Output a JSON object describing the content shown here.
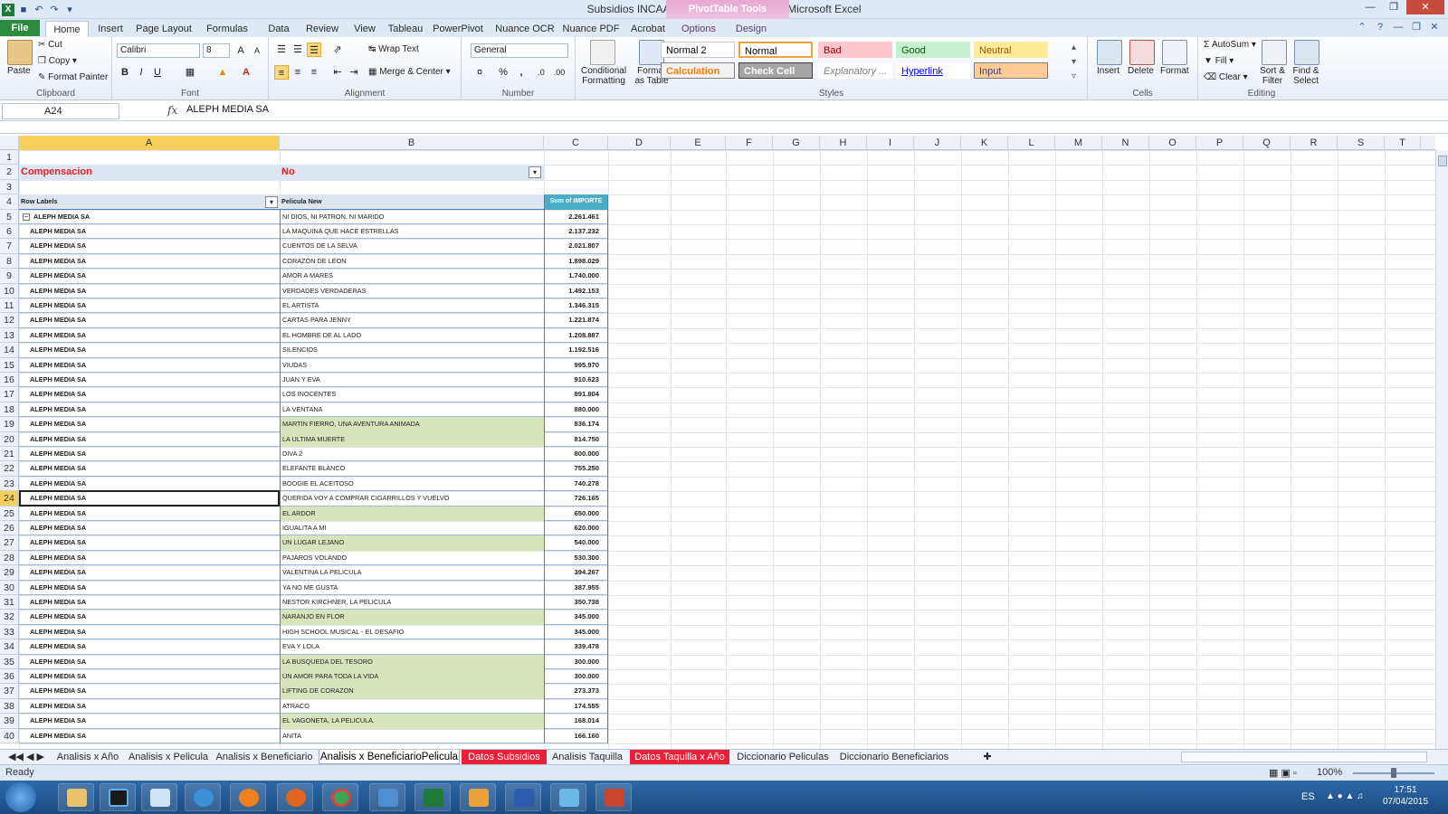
{
  "window": {
    "title": "Subsidios INCAA Analisis20141117.xlsx - Microsoft Excel",
    "contextual_tab_group": "PivotTable Tools"
  },
  "tabs": [
    "File",
    "Home",
    "Insert",
    "Page Layout",
    "Formulas",
    "Data",
    "Review",
    "View",
    "Tableau",
    "PowerPivot",
    "Nuance OCR",
    "Nuance PDF",
    "Acrobat",
    "Options",
    "Design"
  ],
  "ribbon": {
    "clipboard": {
      "paste": "Paste",
      "cut": "Cut",
      "copy": "Copy",
      "format_painter": "Format Painter",
      "label": "Clipboard"
    },
    "font": {
      "name": "Calibri",
      "size": "8",
      "label": "Font",
      "bold": "B",
      "italic": "I",
      "underline": "U"
    },
    "alignment": {
      "wrap_text": "Wrap Text",
      "merge_center": "Merge & Center",
      "label": "Alignment"
    },
    "number": {
      "format": "General",
      "label": "Number",
      "percent": "%",
      "comma": ","
    },
    "styles": {
      "conditional_formatting": "Conditional Formatting",
      "format_as_table": "Format as Table",
      "label": "Styles",
      "gallery": [
        {
          "name": "Normal 2",
          "bg": "#ffffff",
          "fg": "#000000",
          "border": "#c9c9c9"
        },
        {
          "name": "Normal",
          "bg": "#ffffff",
          "fg": "#000000",
          "border": "#f0a33a"
        },
        {
          "name": "Bad",
          "bg": "#ffc7ce",
          "fg": "#9c0006",
          "border": "#ffc7ce"
        },
        {
          "name": "Good",
          "bg": "#c6efce",
          "fg": "#006100",
          "border": "#c6efce"
        },
        {
          "name": "Neutral",
          "bg": "#ffeb9c",
          "fg": "#9c5700",
          "border": "#ffeb9c"
        },
        {
          "name": "Calculation",
          "bg": "#f2f2f2",
          "fg": "#fa7d00",
          "border": "#7f7f7f"
        },
        {
          "name": "Check Cell",
          "bg": "#a5a5a5",
          "fg": "#ffffff",
          "border": "#3f3f3f"
        },
        {
          "name": "Explanatory ...",
          "bg": "#ffffff",
          "fg": "#7f7f7f",
          "border": "#ffffff"
        },
        {
          "name": "Hyperlink",
          "bg": "#ffffff",
          "fg": "#0000ff",
          "border": "#ffffff"
        },
        {
          "name": "Input",
          "bg": "#ffcc99",
          "fg": "#3f3f76",
          "border": "#7f7f7f"
        }
      ]
    },
    "cells": {
      "insert": "Insert",
      "delete": "Delete",
      "format": "Format",
      "label": "Cells"
    },
    "editing": {
      "autosum": "AutoSum",
      "fill": "Fill",
      "clear": "Clear",
      "sort_filter": "Sort & Filter",
      "find_select": "Find & Select",
      "label": "Editing"
    }
  },
  "formula_bar": {
    "name_box": "A24",
    "fx": "fx",
    "content": "ALEPH MEDIA SA"
  },
  "columns": [
    "A",
    "B",
    "C",
    "D",
    "E",
    "F",
    "G",
    "H",
    "I",
    "J",
    "K",
    "L",
    "M",
    "N",
    "O",
    "P",
    "Q",
    "R",
    "S",
    "T"
  ],
  "rows": [
    "1",
    "2",
    "3",
    "4",
    "5",
    "6",
    "7",
    "8",
    "9",
    "10",
    "11",
    "12",
    "13",
    "14",
    "15",
    "16",
    "17",
    "18",
    "19",
    "20",
    "21",
    "22",
    "23",
    "24",
    "25",
    "26",
    "27",
    "28",
    "29",
    "30",
    "31",
    "32",
    "33",
    "34",
    "35",
    "36",
    "37",
    "38",
    "39",
    "40"
  ],
  "pivot": {
    "filter_label": "Compensacion",
    "filter_value": "No",
    "header_row_labels": "Row Labels",
    "header_pelicula": "Pelicula New",
    "header_sum": "Sum of IMPORTE",
    "filter_color": "#e21f26",
    "highlight_color": "#d8e4bc",
    "header_bg": "#4bacc6",
    "records": [
      {
        "ben": "ALEPH MEDIA SA",
        "pel": "NI DIOS, NI PATRON, NI MARIDO",
        "imp": "2.261.461",
        "hl": false
      },
      {
        "ben": "ALEPH MEDIA SA",
        "pel": "LA MAQUINA QUE HACE ESTRELLAS",
        "imp": "2.137.232",
        "hl": false
      },
      {
        "ben": "ALEPH MEDIA SA",
        "pel": "CUENTOS DE LA SELVA",
        "imp": "2.021.807",
        "hl": false
      },
      {
        "ben": "ALEPH MEDIA SA",
        "pel": "CORAZON DE LEON",
        "imp": "1.898.029",
        "hl": false
      },
      {
        "ben": "ALEPH MEDIA SA",
        "pel": "AMOR A MARES",
        "imp": "1.740.000",
        "hl": false
      },
      {
        "ben": "ALEPH MEDIA SA",
        "pel": "VERDADES VERDADERAS",
        "imp": "1.492.153",
        "hl": false
      },
      {
        "ben": "ALEPH MEDIA SA",
        "pel": "EL ARTISTA",
        "imp": "1.346.315",
        "hl": false
      },
      {
        "ben": "ALEPH MEDIA SA",
        "pel": "CARTAS PARA JENNY",
        "imp": "1.221.874",
        "hl": false
      },
      {
        "ben": "ALEPH MEDIA SA",
        "pel": "EL HOMBRE DE AL LADO",
        "imp": "1.208.887",
        "hl": false
      },
      {
        "ben": "ALEPH MEDIA SA",
        "pel": "SILENCIOS",
        "imp": "1.192.516",
        "hl": false
      },
      {
        "ben": "ALEPH MEDIA SA",
        "pel": "VIUDAS",
        "imp": "995.970",
        "hl": false
      },
      {
        "ben": "ALEPH MEDIA SA",
        "pel": "JUAN Y EVA",
        "imp": "910.623",
        "hl": false
      },
      {
        "ben": "ALEPH MEDIA SA",
        "pel": "LOS INOCENTES",
        "imp": "891.804",
        "hl": false
      },
      {
        "ben": "ALEPH MEDIA SA",
        "pel": "LA VENTANA",
        "imp": "880.000",
        "hl": false
      },
      {
        "ben": "ALEPH MEDIA SA",
        "pel": "MARTIN FIERRO, UNA AVENTURA ANIMADA",
        "imp": "836.174",
        "hl": true
      },
      {
        "ben": "ALEPH MEDIA SA",
        "pel": "LA ULTIMA MUERTE",
        "imp": "814.750",
        "hl": true
      },
      {
        "ben": "ALEPH MEDIA SA",
        "pel": "DIVA 2",
        "imp": "800.000",
        "hl": false
      },
      {
        "ben": "ALEPH MEDIA SA",
        "pel": "ELEFANTE BLANCO",
        "imp": "755.250",
        "hl": false
      },
      {
        "ben": "ALEPH MEDIA SA",
        "pel": "BOOGIE EL ACEITOSO",
        "imp": "740.278",
        "hl": false
      },
      {
        "ben": "ALEPH MEDIA SA",
        "pel": "QUERIDA VOY A COMPRAR CIGARRILLOS Y VUELVO",
        "imp": "726.165",
        "hl": false
      },
      {
        "ben": "ALEPH MEDIA SA",
        "pel": "EL ARDOR",
        "imp": "650.000",
        "hl": true
      },
      {
        "ben": "ALEPH MEDIA SA",
        "pel": "IGUALITA A MI",
        "imp": "620.000",
        "hl": false
      },
      {
        "ben": "ALEPH MEDIA SA",
        "pel": "UN LUGAR LEJANO",
        "imp": "540.000",
        "hl": true
      },
      {
        "ben": "ALEPH MEDIA SA",
        "pel": "PAJAROS VOLANDO",
        "imp": "530.300",
        "hl": false
      },
      {
        "ben": "ALEPH MEDIA SA",
        "pel": "VALENTINA LA PELICULA",
        "imp": "394.267",
        "hl": false
      },
      {
        "ben": "ALEPH MEDIA SA",
        "pel": "YA NO ME GUSTA",
        "imp": "387.955",
        "hl": false
      },
      {
        "ben": "ALEPH MEDIA SA",
        "pel": "NESTOR KIRCHNER, LA PELICULA",
        "imp": "350.738",
        "hl": false
      },
      {
        "ben": "ALEPH MEDIA SA",
        "pel": "NARANJO EN FLOR",
        "imp": "345.000",
        "hl": true
      },
      {
        "ben": "ALEPH MEDIA SA",
        "pel": "HIGH SCHOOL MUSICAL - EL DESAFIO",
        "imp": "345.000",
        "hl": false
      },
      {
        "ben": "ALEPH MEDIA SA",
        "pel": "EVA Y LOLA",
        "imp": "339.478",
        "hl": false
      },
      {
        "ben": "ALEPH MEDIA SA",
        "pel": "LA BUSQUEDA DEL TESORO",
        "imp": "300.000",
        "hl": true
      },
      {
        "ben": "ALEPH MEDIA SA",
        "pel": "UN AMOR PARA TODA LA VIDA",
        "imp": "300.000",
        "hl": true
      },
      {
        "ben": "ALEPH MEDIA SA",
        "pel": "LIFTING DE CORAZON",
        "imp": "273.373",
        "hl": true
      },
      {
        "ben": "ALEPH MEDIA SA",
        "pel": "ATRACO",
        "imp": "174.555",
        "hl": false
      },
      {
        "ben": "ALEPH MEDIA SA",
        "pel": "EL VAGONETA, LA PELICULA.",
        "imp": "168.014",
        "hl": true
      },
      {
        "ben": "ALEPH MEDIA SA",
        "pel": "ANITA",
        "imp": "166.160",
        "hl": false
      }
    ]
  },
  "sheets": [
    {
      "name": "Analisis x Año",
      "active": false,
      "red": false
    },
    {
      "name": "Analisis x Pelicula",
      "active": false,
      "red": false
    },
    {
      "name": "Analisis x Beneficiario",
      "active": false,
      "red": false
    },
    {
      "name": "Analisis x BeneficiarioPelicula",
      "active": true,
      "red": false
    },
    {
      "name": "Datos Subsidios",
      "active": false,
      "red": true
    },
    {
      "name": "Analisis Taquilla",
      "active": false,
      "red": false
    },
    {
      "name": "Datos Taquilla x Año",
      "active": false,
      "red": true
    },
    {
      "name": "Diccionario Peliculas",
      "active": false,
      "red": false
    },
    {
      "name": "Diccionario Beneficiarios",
      "active": false,
      "red": false
    }
  ],
  "status": {
    "ready": "Ready",
    "zoom": "100%",
    "zoom_fraction": 0.5
  },
  "taskbar": {
    "lang": "ES",
    "time": "17:51",
    "date": "07/04/2015"
  }
}
